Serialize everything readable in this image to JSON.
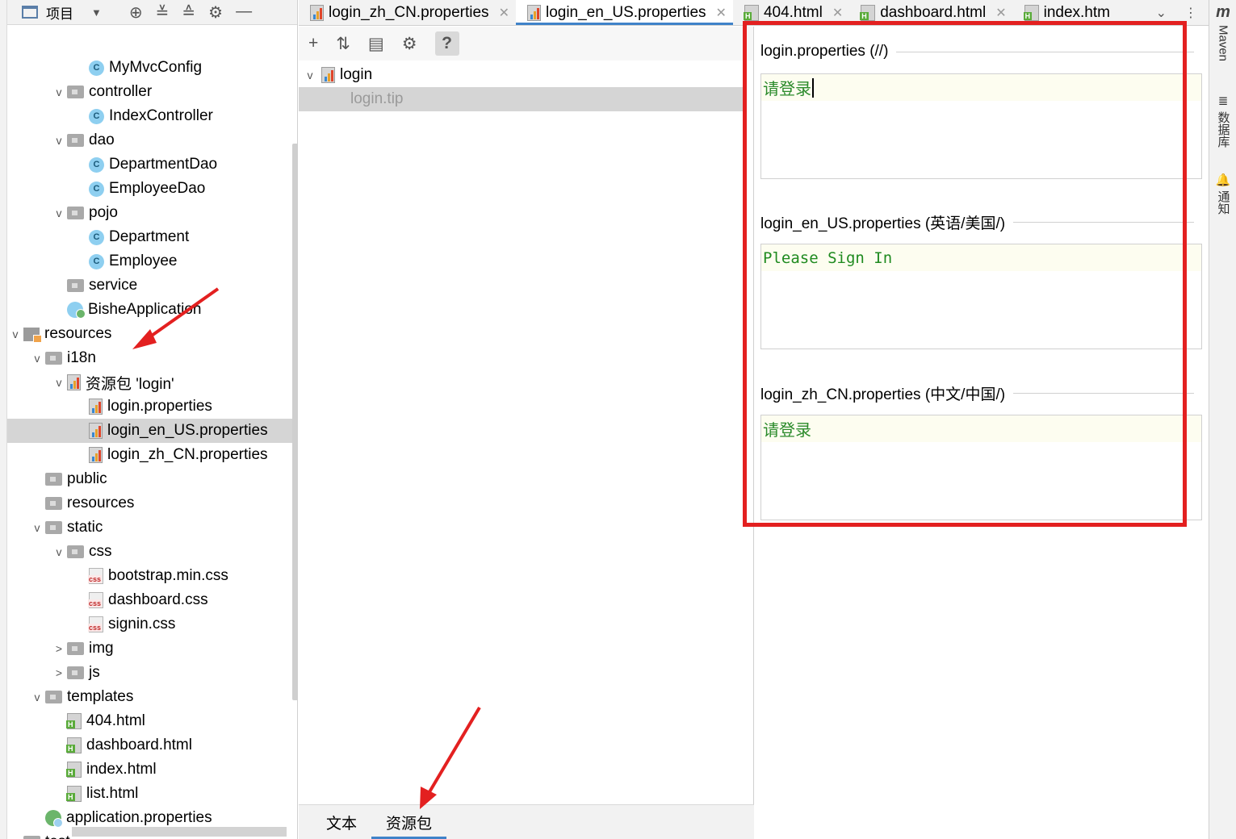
{
  "project_panel": {
    "title": "项目",
    "tree": [
      {
        "label": "MyMvcConfig",
        "icon": "class-icon",
        "indent": 3,
        "toggle": ""
      },
      {
        "label": "controller",
        "icon": "folder-icon",
        "indent": 2,
        "toggle": "v"
      },
      {
        "label": "IndexController",
        "icon": "class-icon",
        "indent": 3,
        "toggle": ""
      },
      {
        "label": "dao",
        "icon": "folder-icon",
        "indent": 2,
        "toggle": "v"
      },
      {
        "label": "DepartmentDao",
        "icon": "class-icon",
        "indent": 3,
        "toggle": ""
      },
      {
        "label": "EmployeeDao",
        "icon": "class-icon",
        "indent": 3,
        "toggle": ""
      },
      {
        "label": "pojo",
        "icon": "folder-icon",
        "indent": 2,
        "toggle": "v"
      },
      {
        "label": "Department",
        "icon": "class-icon",
        "indent": 3,
        "toggle": ""
      },
      {
        "label": "Employee",
        "icon": "class-icon",
        "indent": 3,
        "toggle": ""
      },
      {
        "label": "service",
        "icon": "folder-icon",
        "indent": 2,
        "toggle": ""
      },
      {
        "label": "BisheApplication",
        "icon": "spring-boot-class-icon",
        "indent": 2,
        "toggle": ""
      },
      {
        "label": "resources",
        "icon": "resources-folder-icon",
        "indent": 0,
        "toggle": "v"
      },
      {
        "label": "i18n",
        "icon": "folder-icon",
        "indent": 1,
        "toggle": "v"
      },
      {
        "label": "资源包 'login'",
        "icon": "resource-bundle-icon",
        "indent": 2,
        "toggle": "v"
      },
      {
        "label": "login.properties",
        "icon": "properties-file-icon",
        "indent": 3,
        "toggle": ""
      },
      {
        "label": "login_en_US.properties",
        "icon": "properties-file-icon",
        "indent": 3,
        "toggle": "",
        "selected": true
      },
      {
        "label": "login_zh_CN.properties",
        "icon": "properties-file-icon",
        "indent": 3,
        "toggle": ""
      },
      {
        "label": "public",
        "icon": "folder-icon",
        "indent": 1,
        "toggle": ""
      },
      {
        "label": "resources",
        "icon": "folder-icon",
        "indent": 1,
        "toggle": ""
      },
      {
        "label": "static",
        "icon": "folder-icon",
        "indent": 1,
        "toggle": "v"
      },
      {
        "label": "css",
        "icon": "folder-icon",
        "indent": 2,
        "toggle": "v"
      },
      {
        "label": "bootstrap.min.css",
        "icon": "css-file-icon",
        "indent": 3,
        "toggle": ""
      },
      {
        "label": "dashboard.css",
        "icon": "css-file-icon",
        "indent": 3,
        "toggle": ""
      },
      {
        "label": "signin.css",
        "icon": "css-file-icon",
        "indent": 3,
        "toggle": ""
      },
      {
        "label": "img",
        "icon": "folder-icon",
        "indent": 2,
        "toggle": ">"
      },
      {
        "label": "js",
        "icon": "folder-icon",
        "indent": 2,
        "toggle": ">"
      },
      {
        "label": "templates",
        "icon": "folder-icon",
        "indent": 1,
        "toggle": "v"
      },
      {
        "label": "404.html",
        "icon": "html-file-icon",
        "indent": 2,
        "toggle": ""
      },
      {
        "label": "dashboard.html",
        "icon": "html-file-icon",
        "indent": 2,
        "toggle": ""
      },
      {
        "label": "index.html",
        "icon": "html-file-icon",
        "indent": 2,
        "toggle": ""
      },
      {
        "label": "list.html",
        "icon": "html-file-icon",
        "indent": 2,
        "toggle": ""
      },
      {
        "label": "application.properties",
        "icon": "spring-properties-icon",
        "indent": 1,
        "toggle": ""
      },
      {
        "label": "test",
        "icon": "folder-icon",
        "indent": 0,
        "toggle": ""
      }
    ]
  },
  "editor_tabs": [
    {
      "label": "login_zh_CN.properties",
      "icon": "properties-file-icon",
      "active": false
    },
    {
      "label": "login_en_US.properties",
      "icon": "properties-file-icon",
      "active": true
    },
    {
      "label": "404.html",
      "icon": "html-file-icon",
      "active": false
    },
    {
      "label": "dashboard.html",
      "icon": "html-file-icon",
      "active": false
    },
    {
      "label": "index.htm",
      "icon": "html-file-icon",
      "active": false
    }
  ],
  "bundle_tree": {
    "root": "login",
    "keys": [
      "login.tip"
    ]
  },
  "bottom_tabs": {
    "text": "文本",
    "bundle": "资源包"
  },
  "sections": [
    {
      "title": "login.properties (//)",
      "value": "请登录",
      "mono": false,
      "caret": true
    },
    {
      "title": "login_en_US.properties (英语/美国/)",
      "value": "Please Sign In",
      "mono": true,
      "caret": false
    },
    {
      "title": "login_zh_CN.properties (中文/中国/)",
      "value": "请登录",
      "mono": false,
      "caret": false
    }
  ],
  "right_strip": {
    "maven": "Maven",
    "database": "数据库",
    "notifications": "通知"
  },
  "colors": {
    "accent": "#4083c9",
    "annotation_red": "#e32020",
    "value_green": "#2a8a2a"
  }
}
